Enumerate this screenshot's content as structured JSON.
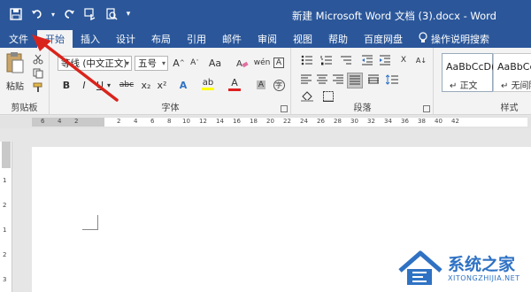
{
  "window": {
    "title": "新建 Microsoft Word 文档 (3).docx  -  Word"
  },
  "tabs": [
    {
      "label": "文件"
    },
    {
      "label": "开始"
    },
    {
      "label": "插入"
    },
    {
      "label": "设计"
    },
    {
      "label": "布局"
    },
    {
      "label": "引用"
    },
    {
      "label": "邮件"
    },
    {
      "label": "审阅"
    },
    {
      "label": "视图"
    },
    {
      "label": "帮助"
    },
    {
      "label": "百度网盘"
    }
  ],
  "tellme": {
    "label": "操作说明搜索"
  },
  "ribbon": {
    "clipboard": {
      "label": "剪贴板",
      "paste_label": "粘贴"
    },
    "font": {
      "label": "字体",
      "font_name": "等线 (中文正文)",
      "font_size": "五号",
      "bold": "B",
      "italic": "I",
      "underline": "U",
      "strike": "abc",
      "subscript": "x₂",
      "superscript": "x²"
    },
    "paragraph": {
      "label": "段落"
    },
    "styles": {
      "label": "样式",
      "items": [
        {
          "preview": "AaBbCcD(",
          "name": "正文"
        },
        {
          "preview": "AaBbCcD(",
          "name": "无间隔"
        }
      ]
    }
  },
  "ruler": {
    "ticks": [
      "6",
      "4",
      "2",
      "2",
      "4",
      "6",
      "8",
      "10",
      "12",
      "14",
      "16",
      "18",
      "20",
      "22",
      "24",
      "26",
      "28",
      "30",
      "32",
      "34",
      "36",
      "38",
      "40",
      "42"
    ]
  },
  "vruler": {
    "ticks": [
      "1",
      "2",
      "1",
      "2",
      "3"
    ]
  },
  "watermark": {
    "main": "系统之家",
    "sub": "XITONGZHIJIA.NET"
  },
  "colors": {
    "brand": "#2b579a",
    "arrow": "#d9241c",
    "watermark": "#2f72c4"
  }
}
